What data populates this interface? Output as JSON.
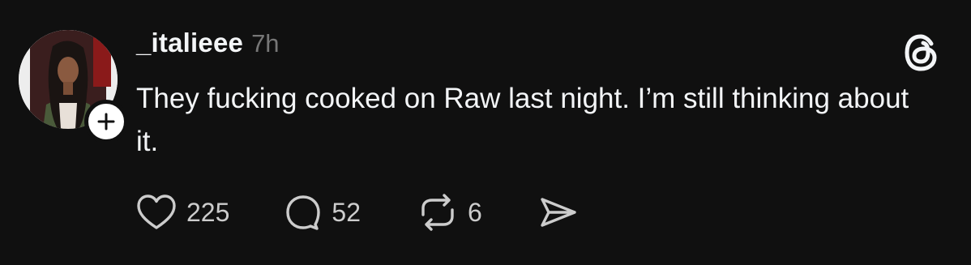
{
  "post": {
    "username": "_italieee",
    "timestamp": "7h",
    "text": "They fucking cooked on Raw last night. I’m still thinking about it.",
    "likes": "225",
    "replies": "52",
    "reposts": "6"
  },
  "icons": {
    "avatar": "profile-photo",
    "follow": "plus-icon",
    "logo": "threads-logo-icon",
    "like": "heart-icon",
    "reply": "comment-icon",
    "repost": "repost-icon",
    "share": "send-icon"
  },
  "colors": {
    "background": "#101010",
    "text": "#f3f5f7",
    "muted": "#777777"
  }
}
